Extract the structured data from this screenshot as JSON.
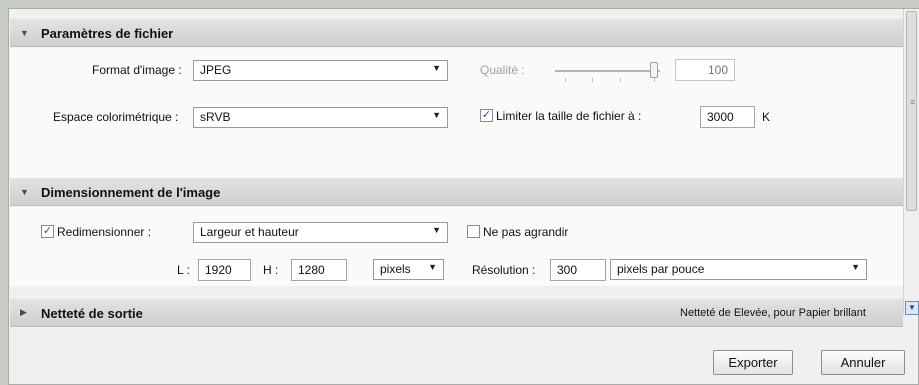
{
  "file_settings": {
    "title": "Paramètres de fichier",
    "format_label": "Format d'image :",
    "format_value": "JPEG",
    "quality_label": "Qualité :",
    "quality_value": "100",
    "quality_level_percent": 100,
    "colorspace_label": "Espace colorimétrique :",
    "colorspace_value": "sRVB",
    "limit_label": "Limiter la taille de fichier à :",
    "limit_checked": true,
    "limit_value": "3000",
    "limit_unit": "K"
  },
  "image_sizing": {
    "title": "Dimensionnement de l'image",
    "resize_label": "Redimensionner :",
    "resize_checked": true,
    "resize_mode": "Largeur et hauteur",
    "no_enlarge_label": "Ne pas agrandir",
    "no_enlarge_checked": false,
    "width_label": "L :",
    "width_value": "1920",
    "height_label": "H :",
    "height_value": "1280",
    "unit_value": "pixels",
    "resolution_label": "Résolution :",
    "resolution_value": "300",
    "resolution_unit": "pixels par pouce"
  },
  "sharpening": {
    "title": "Netteté de sortie",
    "summary": "Netteté de Elevée, pour Papier brillant"
  },
  "buttons": {
    "export": "Exporter",
    "cancel": "Annuler"
  },
  "icons": {
    "expanded": "triangle-down-icon",
    "collapsed": "triangle-right-icon",
    "dropdown": "chevron-down-icon",
    "check": "checkmark-icon"
  }
}
